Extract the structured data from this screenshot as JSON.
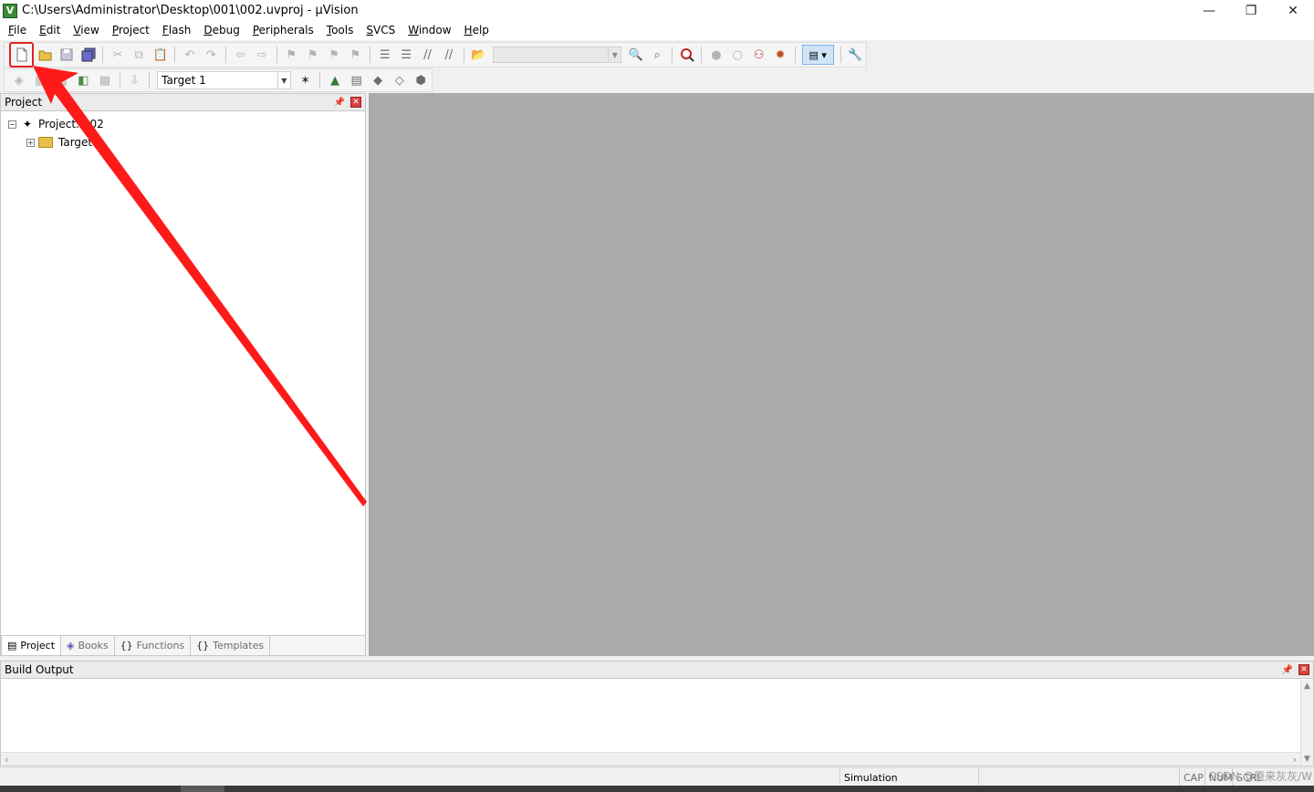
{
  "window": {
    "title": "C:\\Users\\Administrator\\Desktop\\001\\002.uvproj - µVision",
    "app_icon": "V",
    "controls": {
      "minimize": "—",
      "restore": "❐",
      "close": "✕"
    }
  },
  "menu": [
    {
      "acc": "F",
      "rest": "ile"
    },
    {
      "acc": "E",
      "rest": "dit"
    },
    {
      "acc": "V",
      "rest": "iew"
    },
    {
      "acc": "P",
      "rest": "roject"
    },
    {
      "acc": "F",
      "rest": "lash"
    },
    {
      "acc": "D",
      "rest": "ebug"
    },
    {
      "acc": "P",
      "rest": "eripherals"
    },
    {
      "acc": "T",
      "rest": "ools"
    },
    {
      "acc": "S",
      "rest": "VCS"
    },
    {
      "acc": "W",
      "rest": "indow"
    },
    {
      "acc": "H",
      "rest": "elp"
    }
  ],
  "toolbar2": {
    "target_select": "Target 1"
  },
  "project_panel": {
    "title": "Project",
    "tree": {
      "root": "Project: 002",
      "child": "Target 1"
    },
    "tabs": [
      {
        "label": "Project",
        "icon": "project-tab-icon"
      },
      {
        "label": "Books",
        "icon": "books-tab-icon"
      },
      {
        "label": "Functions",
        "icon": "functions-tab-icon"
      },
      {
        "label": "Templates",
        "icon": "templates-tab-icon"
      }
    ]
  },
  "build_output": {
    "title": "Build Output"
  },
  "statusbar": {
    "mode": "Simulation",
    "caps": "CAP",
    "num": "NUM",
    "scrl": "SCRL",
    "watermark": "CSDN @原来灰灰/W"
  },
  "colors": {
    "editor_bg": "#ababab",
    "annotation": "#ff2020",
    "highlight_box": "#e02020"
  }
}
